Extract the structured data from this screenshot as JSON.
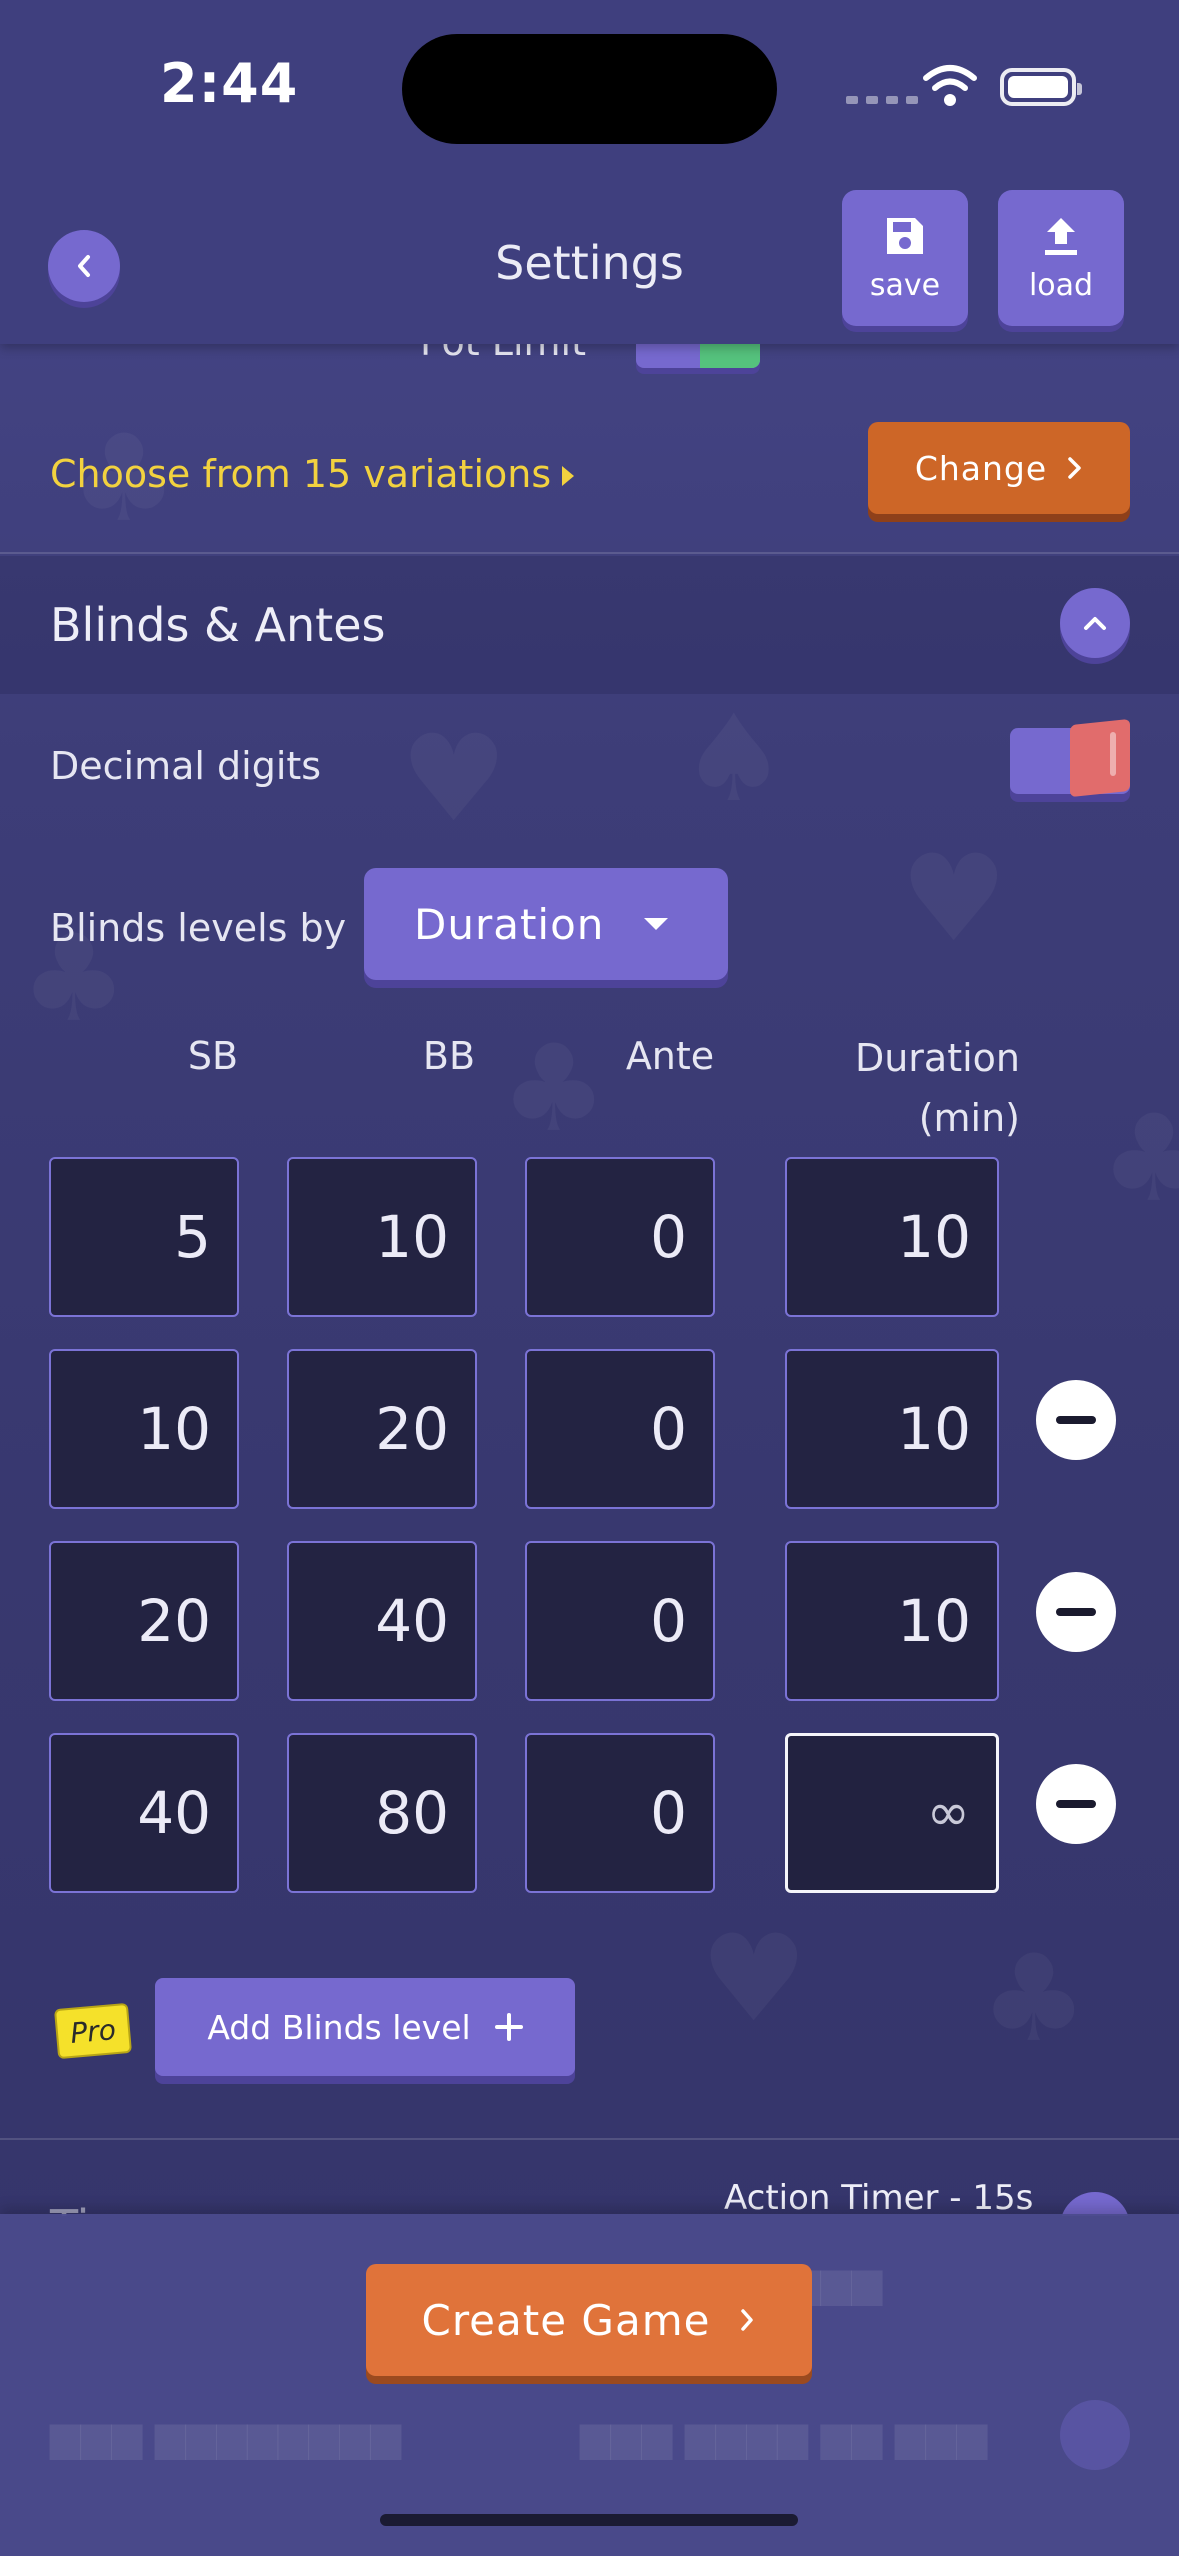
{
  "status_bar": {
    "time": "2:44"
  },
  "header": {
    "title": "Settings",
    "save_label": "save",
    "load_label": "load"
  },
  "game_variant": {
    "peek_label": "Pot Limit",
    "variations_text": "Choose from 15 variations",
    "change_label": "Change"
  },
  "blinds_section": {
    "title": "Blinds & Antes",
    "decimal_digits_label": "Decimal digits",
    "decimal_digits_enabled": false,
    "levels_by_label": "Blinds levels by",
    "levels_by_value": "Duration",
    "columns": [
      "SB",
      "BB",
      "Ante",
      "Duration",
      "(min)"
    ],
    "levels": [
      {
        "sb": "5",
        "bb": "10",
        "ante": "0",
        "duration": "10"
      },
      {
        "sb": "10",
        "bb": "20",
        "ante": "0",
        "duration": "10"
      },
      {
        "sb": "20",
        "bb": "40",
        "ante": "0",
        "duration": "10"
      },
      {
        "sb": "40",
        "bb": "80",
        "ante": "0",
        "duration": "∞"
      }
    ],
    "pro_badge": "Pro",
    "add_level_label": "Add Blinds level"
  },
  "timers_section": {
    "title": "Timers",
    "summary": "Action Timer - 15s"
  },
  "footer": {
    "create_label": "Create Game"
  },
  "colors": {
    "accent": "#7669cf",
    "orange": "#e0733a",
    "yellow_text": "#f2d23f",
    "background": "#3c3c75"
  }
}
